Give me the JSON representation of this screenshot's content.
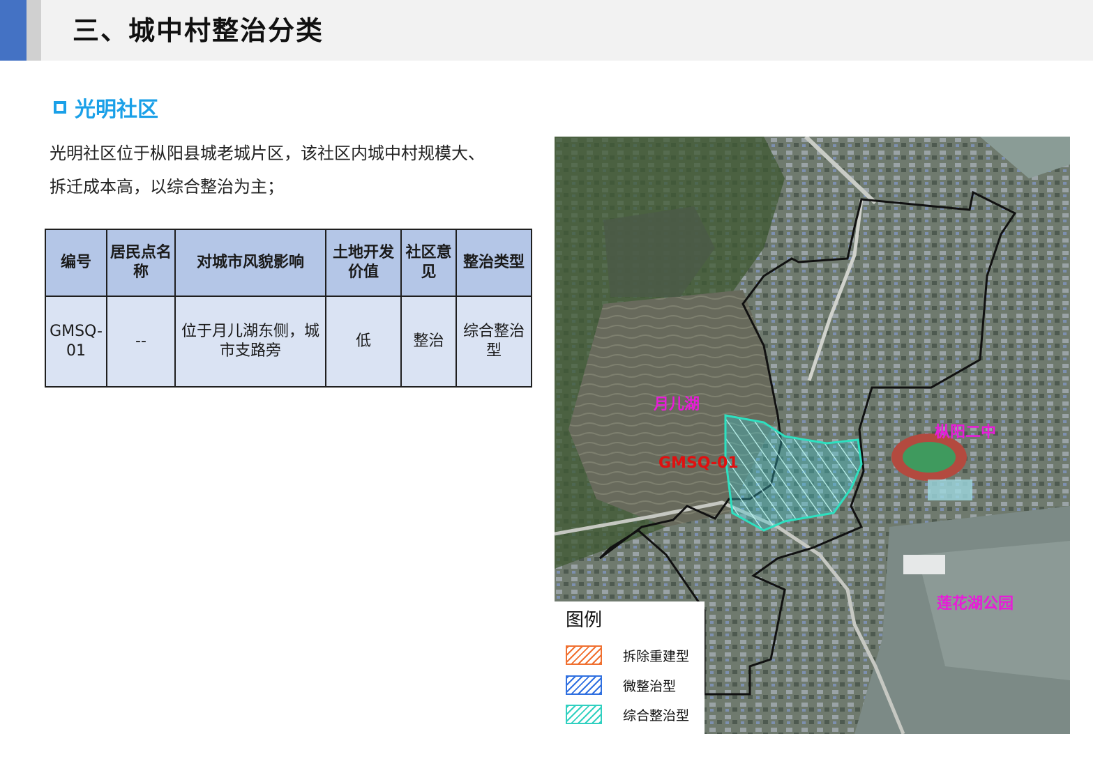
{
  "header": {
    "title": "三、城中村整治分类"
  },
  "section": {
    "title": "光明社区"
  },
  "description": {
    "line1": "光明社区位于枞阳县城老城片区，该社区内城中村规模大、",
    "line2": "拆迁成本高，以综合整治为主；"
  },
  "table": {
    "headers": [
      "编号",
      "居民点名称",
      "对城市风貌影响",
      "土地开发价值",
      "社区意见",
      "整治类型"
    ],
    "rows": [
      [
        "GMSQ-01",
        "--",
        "位于月儿湖东侧，城市支路旁",
        "低",
        "整治",
        "综合整治型"
      ]
    ]
  },
  "map": {
    "labels": {
      "lake": "月儿湖",
      "school": "枞阳二中",
      "park": "莲花湖公园",
      "plot": "GMSQ-01"
    },
    "colors": {
      "label": "#e81cd8",
      "plot_label": "#e01010",
      "boundary": "#111111",
      "plot_outline": "#2de0c0"
    }
  },
  "legend": {
    "title": "图例",
    "items": [
      {
        "label": "拆除重建型",
        "color": "#f07030"
      },
      {
        "label": "微整治型",
        "color": "#3070e0"
      },
      {
        "label": "综合整治型",
        "color": "#30d0c0"
      }
    ]
  }
}
